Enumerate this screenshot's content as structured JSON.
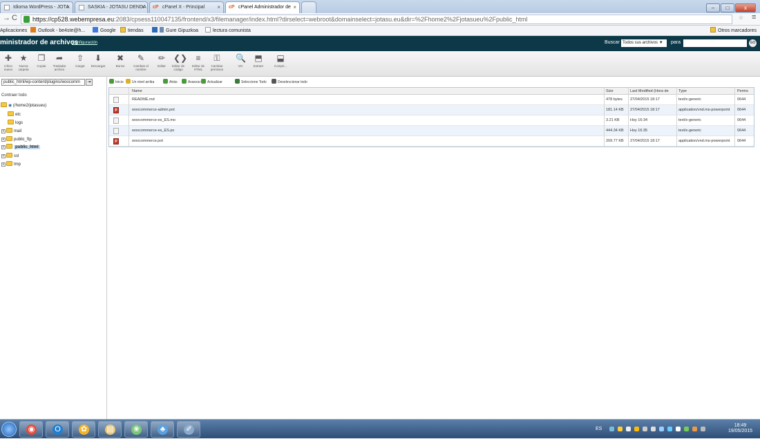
{
  "browser": {
    "tabs": [
      {
        "label": "Idioma WordPress - JOTA",
        "active": false
      },
      {
        "label": "SASKIA - JOTASU DENDA",
        "active": false
      },
      {
        "label": "cPanel X - Principal",
        "active": false
      },
      {
        "label": "cPanel Administrador de",
        "active": true
      }
    ],
    "tab_close": "×",
    "cp_mark": "cP",
    "url_host": "https://cp528.webempresa.eu",
    "url_rest": ":2083/cpsess110047135/frontend/x3/filemanager/index.html?dirselect=webroot&domainselect=jotasu.eu&dir=%2Fhome2%2Fjotasueu%2Fpublic_html",
    "bookmarks": [
      {
        "label": "Aplicaciones",
        "icon": "apps-icon"
      },
      {
        "label": "Outlook - be4ste@h...",
        "icon": "outlook-icon"
      },
      {
        "label": "Google",
        "icon": "google-icon"
      },
      {
        "label": "tiendas",
        "icon": "folder-icon"
      },
      {
        "label": "Gure Gipuzkoa",
        "icon": "gipuzkoa-icon"
      },
      {
        "label": "lectura comunista",
        "icon": "page-icon"
      }
    ],
    "other_bookmarks": "Otros marcadores",
    "colors": {
      "tab_bg": "#c9d9ec",
      "accent": "#0d3847"
    }
  },
  "cpanel": {
    "title": "ministrador de archivos",
    "config_link": "Configuración",
    "search_label": "Buscar",
    "search_scope": "Todos sus archivos",
    "search_for": "para",
    "search_go": "GO"
  },
  "toolbar": [
    {
      "label": "rchivo nuevo",
      "icon": "new-file-icon"
    },
    {
      "label": "Nueva carpeta",
      "icon": "new-folder-icon"
    },
    {
      "label": "Copiar",
      "icon": "copy-icon"
    },
    {
      "label": "Trasladar archivo",
      "icon": "move-icon"
    },
    {
      "label": "Cargar",
      "icon": "upload-icon"
    },
    {
      "label": "Descargar",
      "icon": "download-icon"
    },
    {
      "label": "Borrar",
      "icon": "delete-icon"
    },
    {
      "label": "Cambiar el nombre",
      "icon": "rename-icon"
    },
    {
      "label": "Editar",
      "icon": "edit-icon"
    },
    {
      "label": "Editor de código",
      "icon": "code-editor-icon"
    },
    {
      "label": "Editor de HTML",
      "icon": "html-editor-icon"
    },
    {
      "label": "Cambiar permisos",
      "icon": "permissions-icon"
    },
    {
      "label": "Ver",
      "icon": "view-icon"
    },
    {
      "label": "Extraer",
      "icon": "extract-icon"
    },
    {
      "label": "Compri...",
      "icon": "compress-icon"
    }
  ],
  "sidebar": {
    "path_value": "public_html/wp-content/plugins/woocomm",
    "collapse_all": "Contraer todo",
    "root": "(/home2/jotasueu)",
    "items": [
      {
        "label": "etc",
        "expander": false,
        "selected": false
      },
      {
        "label": "logs",
        "expander": false,
        "selected": false
      },
      {
        "label": "mail",
        "expander": true,
        "selected": false
      },
      {
        "label": "public_ftp",
        "expander": true,
        "selected": false
      },
      {
        "label": "public_html",
        "expander": true,
        "selected": true
      },
      {
        "label": "ssl",
        "expander": true,
        "selected": false
      },
      {
        "label": "tmp",
        "expander": true,
        "selected": false
      }
    ]
  },
  "actions": [
    {
      "label": "Inicio",
      "icon": "home-icon",
      "color": "#4a9a3a"
    },
    {
      "label": "Un nivel arriba",
      "icon": "level-up-icon",
      "color": "#d9b12a"
    },
    {
      "label": "Atrás",
      "icon": "back-arrow-icon",
      "color": "#4a9a3a"
    },
    {
      "label": "Avanzar",
      "icon": "forward-arrow-icon",
      "color": "#4a9a3a"
    },
    {
      "label": "Actualizar",
      "icon": "refresh-icon",
      "color": "#4a9a3a"
    },
    {
      "label": "Seleccione Todo",
      "icon": "select-all-icon",
      "color": "#3a7a3a"
    },
    {
      "label": "Deseleccionar todo",
      "icon": "deselect-all-icon",
      "color": "#555555"
    }
  ],
  "table": {
    "headers": [
      "Name",
      "Size",
      "Last Modified (Hora de",
      "Type",
      "Perms"
    ],
    "rows": [
      {
        "name": "README.md",
        "size": "478 bytes",
        "modified": "27/04/2015 18:17",
        "type": "text/x-generic",
        "perms": "0644",
        "icon": "text-file-icon"
      },
      {
        "name": "woocommerce-admin.pot",
        "size": "181.14 KB",
        "modified": "27/04/2015 18:17",
        "type": "application/vnd.ms-powerpoint",
        "perms": "0644",
        "icon": "powerpoint-file-icon"
      },
      {
        "name": "woocommerce-es_ES.mo",
        "size": "3.21 KB",
        "modified": "Hoy 16:34",
        "type": "text/x-generic",
        "perms": "0644",
        "icon": "text-file-icon"
      },
      {
        "name": "woocommerce-es_ES.po",
        "size": "444.34 KB",
        "modified": "Hoy 16:35",
        "type": "text/x-generic",
        "perms": "0644",
        "icon": "text-file-icon"
      },
      {
        "name": "woocommerce.pot",
        "size": "209.77 KB",
        "modified": "27/04/2015 18:17",
        "type": "application/vnd.ms-powerpoint",
        "perms": "0644",
        "icon": "powerpoint-file-icon"
      }
    ]
  },
  "taskbar": {
    "apps": [
      "windows-start-icon",
      "chrome-icon",
      "outlook-icon",
      "media-player-icon",
      "file-explorer-icon",
      "photos-icon",
      "paint-icon",
      "misc-app-icon"
    ],
    "language": "ES",
    "time": "18:49",
    "date": "19/05/2015"
  }
}
